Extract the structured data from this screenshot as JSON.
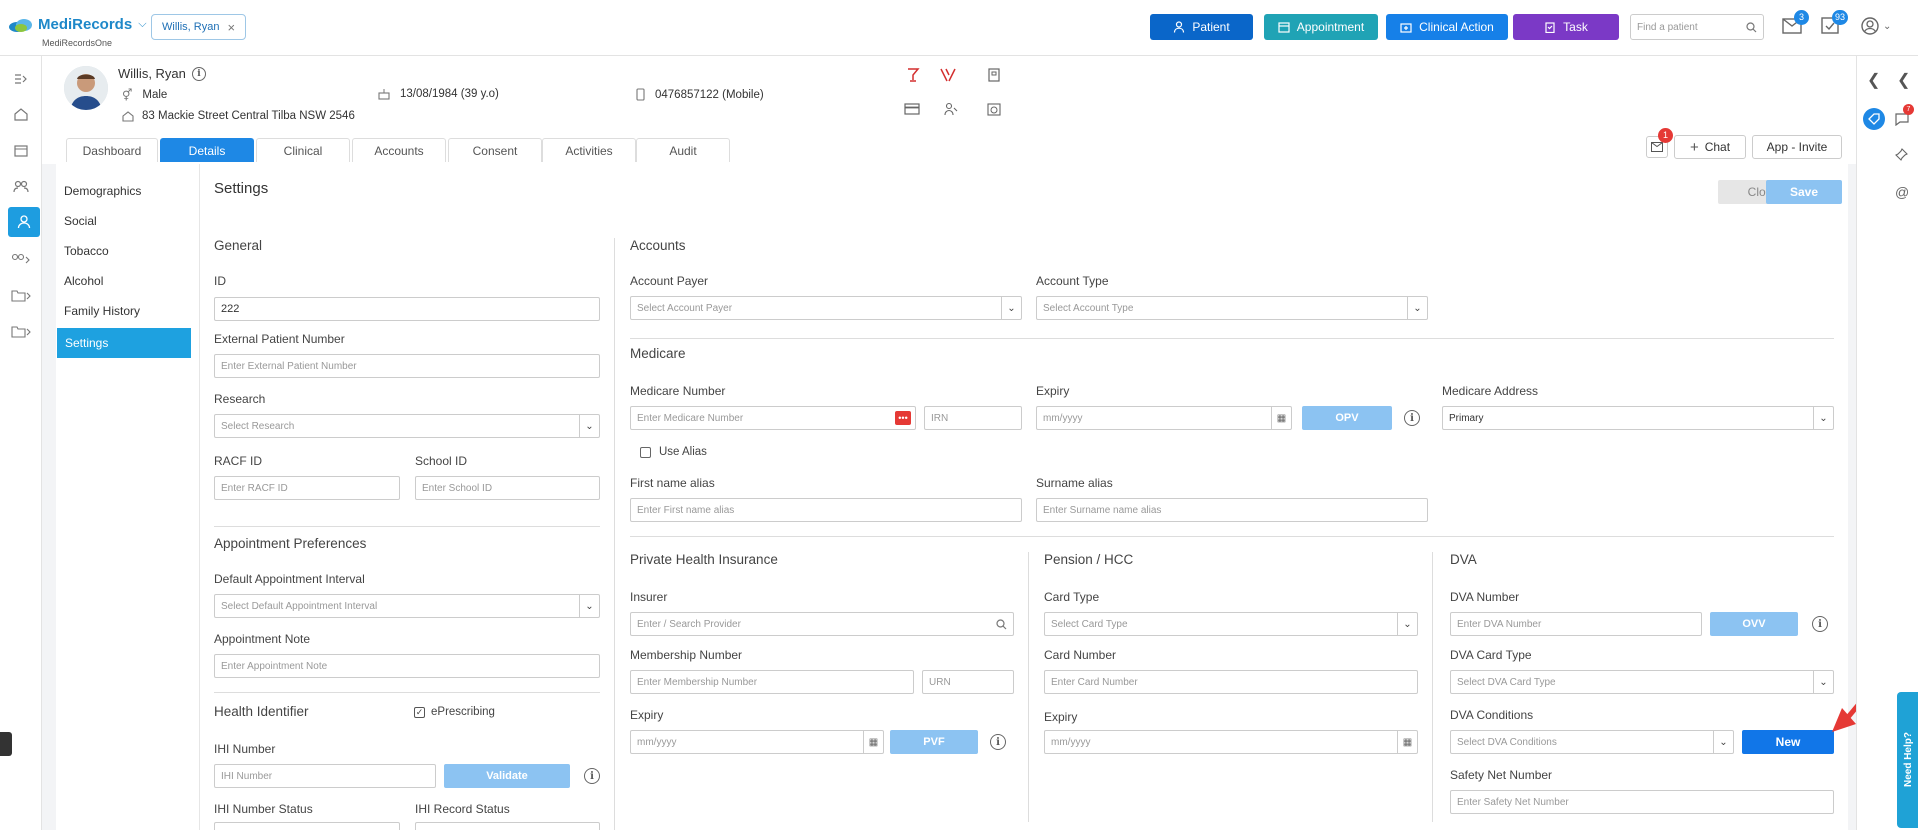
{
  "app": {
    "name": "MediRecords",
    "subtitle": "MediRecordsOne"
  },
  "topbar": {
    "patient_chip": "Willis, Ryan",
    "buttons": {
      "patient": "Patient",
      "appointment": "Appointment",
      "clinical_action": "Clinical Action",
      "task": "Task"
    },
    "search_placeholder": "Find a patient",
    "mail_count": "3",
    "tasks_count": "93",
    "colors": {
      "patient": "#0a66c9",
      "appointment": "#20a3b5",
      "clinical_action": "#1680e8",
      "task": "#7b39c6"
    }
  },
  "patient": {
    "name": "Willis, Ryan",
    "gender": "Male",
    "dob": "13/08/1984 (39 y.o)",
    "phone": "0476857122 (Mobile)",
    "address": "83 Mackie Street Central Tilba NSW 2546"
  },
  "tabs": [
    "Dashboard",
    "Details",
    "Clinical",
    "Accounts",
    "Consent",
    "Activities",
    "Audit"
  ],
  "header_actions": {
    "notif_count": "1",
    "chat": "Chat",
    "app_invite": "App - Invite"
  },
  "submenu": [
    "Demographics",
    "Social",
    "Tobacco",
    "Alcohol",
    "Family History",
    "Settings"
  ],
  "main": {
    "title": "Settings",
    "close": "Close",
    "save": "Save",
    "general": {
      "heading": "General",
      "id_label": "ID",
      "id_value": "222",
      "external_label": "External Patient Number",
      "external_ph": "Enter External Patient Number",
      "research_label": "Research",
      "research_ph": "Select Research",
      "racf_label": "RACF ID",
      "racf_ph": "Enter RACF ID",
      "school_label": "School ID",
      "school_ph": "Enter School ID"
    },
    "appointment_prefs": {
      "heading": "Appointment Preferences",
      "interval_label": "Default Appointment Interval",
      "interval_ph": "Select Default Appointment Interval",
      "note_label": "Appointment Note",
      "note_ph": "Enter Appointment Note"
    },
    "health_identifier": {
      "heading": "Health Identifier",
      "eprescribing": "ePrescribing",
      "ihi_label": "IHI Number",
      "ihi_ph": "IHI Number",
      "validate": "Validate",
      "ihi_status_label": "IHI Number Status",
      "ihi_record_label": "IHI Record Status"
    },
    "accounts": {
      "heading": "Accounts",
      "payer_label": "Account Payer",
      "payer_ph": "Select Account Payer",
      "type_label": "Account Type",
      "type_ph": "Select Account Type"
    },
    "medicare": {
      "heading": "Medicare",
      "number_label": "Medicare Number",
      "number_ph": "Enter Medicare Number",
      "irn_ph": "IRN",
      "expiry_label": "Expiry",
      "expiry_ph": "mm/yyyy",
      "opv": "OPV",
      "address_label": "Medicare Address",
      "address_value": "Primary",
      "use_alias": "Use Alias",
      "first_alias_label": "First name alias",
      "first_alias_ph": "Enter First name alias",
      "surname_alias_label": "Surname alias",
      "surname_alias_ph": "Enter Surname name alias"
    },
    "phi": {
      "heading": "Private Health Insurance",
      "insurer_label": "Insurer",
      "insurer_ph": "Enter / Search Provider",
      "membership_label": "Membership Number",
      "membership_ph": "Enter Membership Number",
      "urn_ph": "URN",
      "expiry_label": "Expiry",
      "expiry_ph": "mm/yyyy",
      "pvf": "PVF"
    },
    "pension": {
      "heading": "Pension / HCC",
      "card_type_label": "Card Type",
      "card_type_ph": "Select Card Type",
      "card_number_label": "Card Number",
      "card_number_ph": "Enter Card Number",
      "expiry_label": "Expiry",
      "expiry_ph": "mm/yyyy"
    },
    "dva": {
      "heading": "DVA",
      "number_label": "DVA Number",
      "number_ph": "Enter DVA Number",
      "ovv": "OVV",
      "card_type_label": "DVA Card Type",
      "card_type_ph": "Select DVA Card Type",
      "conditions_label": "DVA Conditions",
      "conditions_ph": "Select DVA Conditions",
      "new": "New",
      "safety_label": "Safety Net Number",
      "safety_ph": "Enter Safety Net Number"
    }
  },
  "right_rail": {
    "help": "Need Help?",
    "notif_count": "7"
  }
}
